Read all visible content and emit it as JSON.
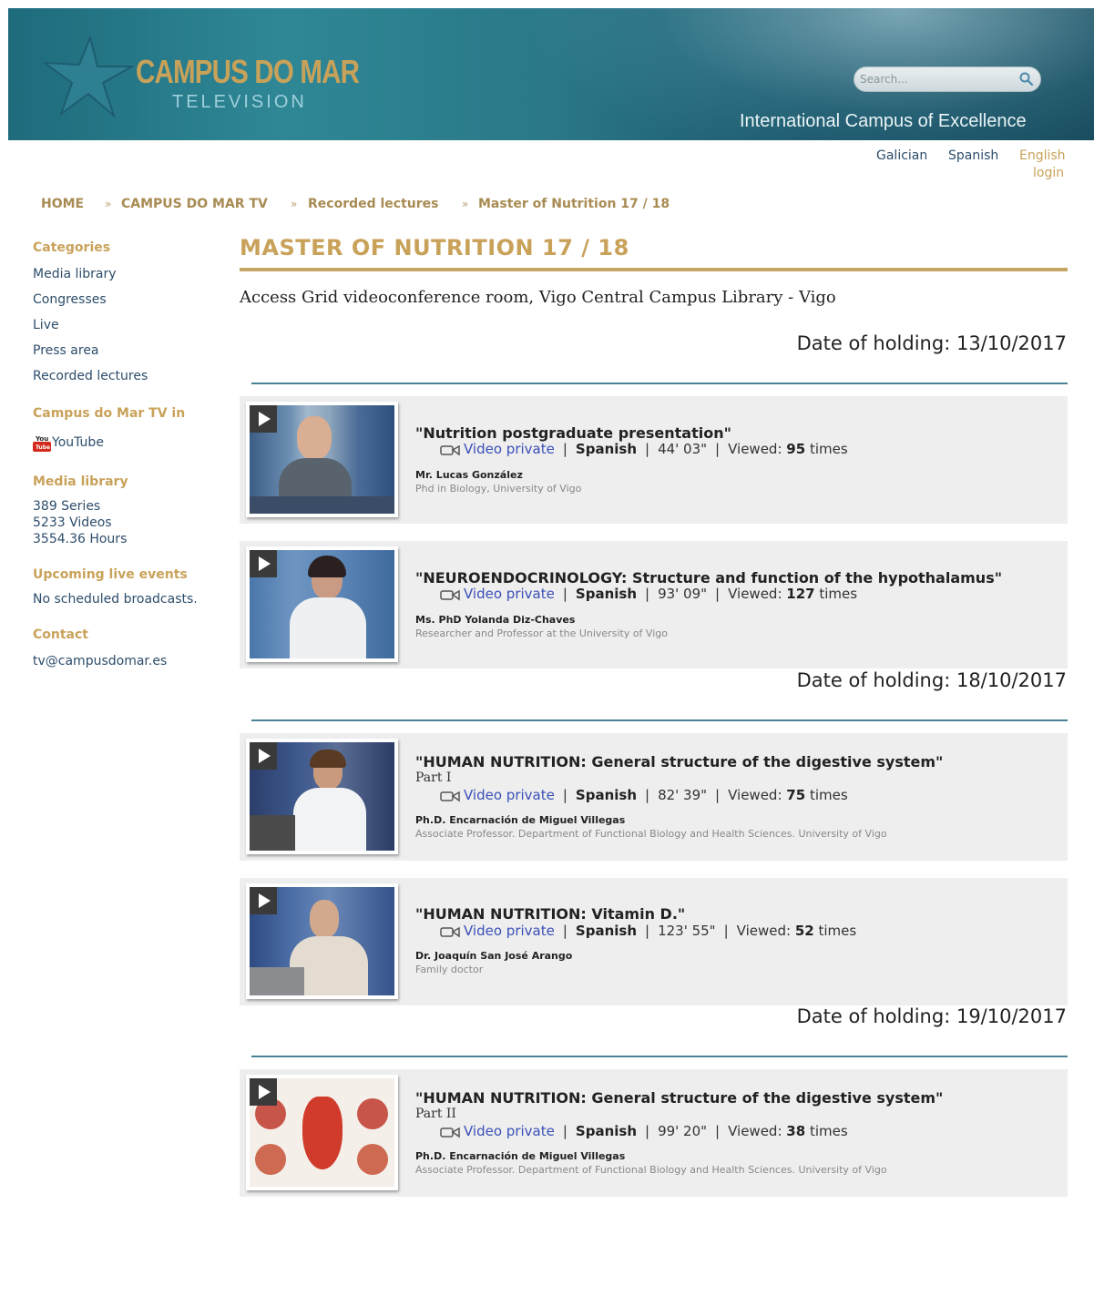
{
  "header": {
    "logo_title": "CAMPUS DO MAR",
    "logo_subtitle": "TELEVISION",
    "search_placeholder": "Search...",
    "tagline": "International Campus of Excellence"
  },
  "languages": [
    "Galician",
    "Spanish",
    "English"
  ],
  "login_label": "login",
  "breadcrumb": [
    "HOME",
    "CAMPUS DO MAR TV",
    "Recorded lectures",
    "Master of Nutrition 17 / 18"
  ],
  "breadcrumb_separator": "»",
  "sidebar": {
    "categories_heading": "Categories",
    "categories": [
      "Media library",
      "Congresses",
      "Live",
      "Press area",
      "Recorded lectures"
    ],
    "tv_in_heading": "Campus do Mar TV in",
    "youtube_label": "YouTube",
    "media_heading": "Media library",
    "media_stats": [
      "389 Series",
      "5233 Videos",
      "3554.36 Hours"
    ],
    "upcoming_heading": "Upcoming live events",
    "upcoming_text": "No scheduled broadcasts.",
    "contact_heading": "Contact",
    "contact_email": "tv@campusdomar.es"
  },
  "main": {
    "title": "MASTER OF NUTRITION 17 / 18",
    "location": "Access Grid videoconference room, Vigo Central Campus Library - Vigo",
    "date_label": "Date of holding:",
    "dates": [
      "13/10/2017",
      "18/10/2017",
      "19/10/2017"
    ]
  },
  "lecture_labels": {
    "video_private": "Video private",
    "separator": "|",
    "viewed": "Viewed:",
    "times": "times"
  },
  "lectures": [
    {
      "title": "\"Nutrition postgraduate presentation\"",
      "part": "",
      "language": "Spanish",
      "duration": "44' 03\"",
      "views": "95",
      "author": "Mr. Lucas González",
      "role": "Phd in Biology, University of Vigo"
    },
    {
      "title": "\"NEUROENDOCRINOLOGY: Structure and function of the hypothalamus\"",
      "part": "",
      "language": "Spanish",
      "duration": "93' 09\"",
      "views": "127",
      "author": "Ms. PhD Yolanda Diz-Chaves",
      "role": "Researcher and Professor at the University of Vigo"
    },
    {
      "title": "\"HUMAN NUTRITION: General structure of the digestive system\"",
      "part": "Part I",
      "language": "Spanish",
      "duration": "82' 39\"",
      "views": "75",
      "author": "Ph.D. Encarnación de Miguel Villegas",
      "role": "Associate Professor. Department of Functional Biology and Health Sciences. University of Vigo"
    },
    {
      "title": "\"HUMAN NUTRITION: Vitamin D.\"",
      "part": "",
      "language": "Spanish",
      "duration": "123' 55\"",
      "views": "52",
      "author": "Dr. Joaquín San José Arango",
      "role": "Family doctor"
    },
    {
      "title": "\"HUMAN NUTRITION: General structure of the digestive system\"",
      "part": "Part II",
      "language": "Spanish",
      "duration": "99' 20\"",
      "views": "38",
      "author": "Ph.D. Encarnación de Miguel Villegas",
      "role": "Associate Professor. Department of Functional Biology and Health Sciences. University of Vigo"
    }
  ],
  "colors": {
    "gold": "#c9a25a",
    "link": "#2d4d6b",
    "video_link": "#3a4fb8",
    "rule": "#4a8295"
  }
}
